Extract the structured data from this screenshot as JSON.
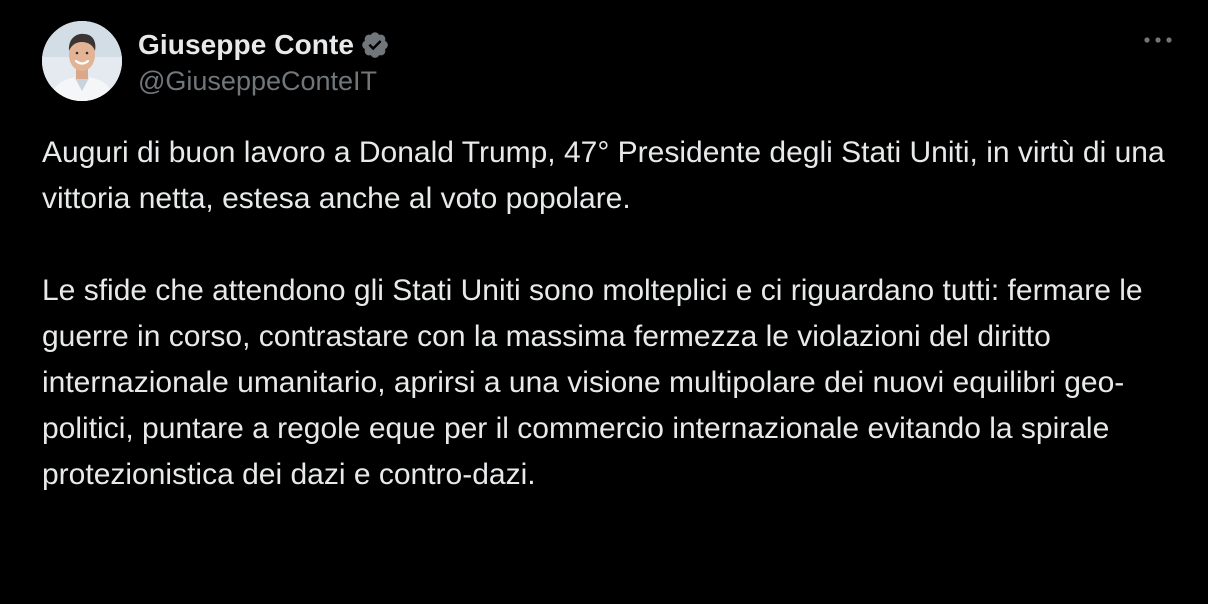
{
  "author": {
    "display_name": "Giuseppe Conte",
    "handle": "@GiuseppeConteIT",
    "verified": true,
    "verified_color": "#71767b",
    "avatar_icon": "profile-photo"
  },
  "tweet": {
    "paragraphs": [
      "Auguri di buon lavoro a Donald Trump, 47° Presidente degli Stati Uniti, in virtù di una vittoria netta, estesa anche al voto popolare.",
      "Le sfide che attendono gli Stati Uniti sono molteplici e ci riguardano tutti: fermare le guerre in corso, contrastare con la massima fermezza le violazioni del diritto internazionale umanitario, aprirsi a una visione multipolare dei nuovi equilibri geo-politici, puntare a regole eque per il commercio internazionale evitando la spirale protezionistica dei dazi e contro-dazi."
    ]
  },
  "menu": {
    "icon": "more-horizontal-icon"
  },
  "theme": {
    "background": "#000000",
    "text_primary": "#e7e9ea",
    "text_secondary": "#71767b"
  }
}
